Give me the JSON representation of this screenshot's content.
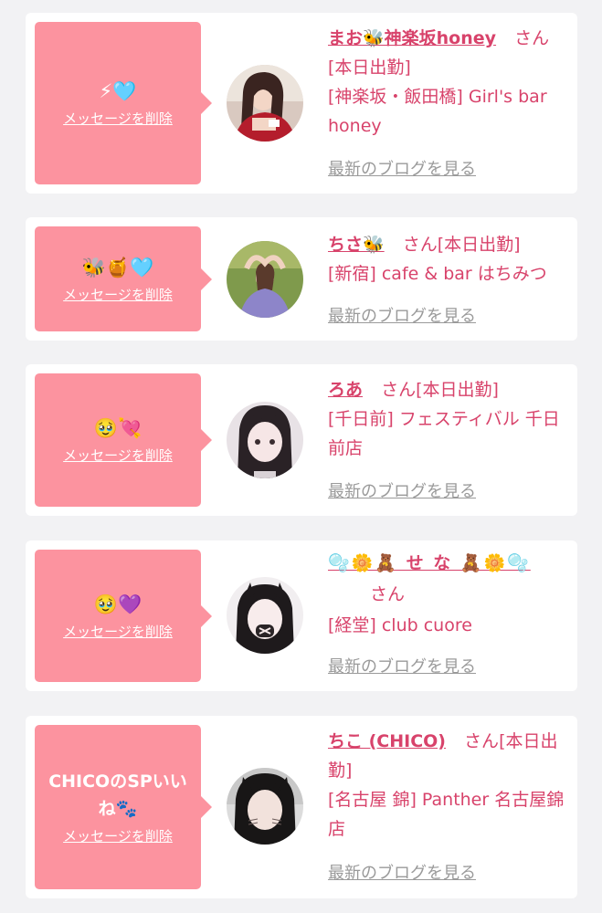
{
  "common": {
    "delete_label": "メッセージを削除",
    "blog_label": "最新のブログを見る",
    "san": "さん",
    "colors": {
      "bubble": "#fc939f",
      "accent": "#d8436b",
      "muted": "#9a9a9a",
      "background": "#f2f2f4"
    }
  },
  "messages": [
    {
      "message": "⚡🩵",
      "name": "まお🐝神楽坂honey",
      "status": "[本日出勤]",
      "shop": "[神楽坂・飯田橋] Girl's bar honey",
      "avatar": "avatar-photo-mao"
    },
    {
      "message": "🐝🍯🩵",
      "name": "ちさ🐝",
      "status": "[本日出勤]",
      "shop": "[新宿] cafe & bar はちみつ",
      "avatar": "avatar-photo-chisa"
    },
    {
      "message": "🥹💘",
      "name": "ろあ",
      "status": "[本日出勤]",
      "shop": "[千日前] フェスティバル 千日前店",
      "avatar": "avatar-photo-roa"
    },
    {
      "message": "🥹💜",
      "name": "🫧🌼🧸 せ な 🧸🌼🫧",
      "status": "",
      "shop": "[経堂] club cuore",
      "avatar": "avatar-photo-sena"
    },
    {
      "message": "CHICOのSPいいね🐾",
      "name": "ちこ (CHICO)",
      "status": "[本日出勤]",
      "shop": "[名古屋 錦] Panther 名古屋錦店",
      "avatar": "avatar-photo-chico"
    }
  ]
}
